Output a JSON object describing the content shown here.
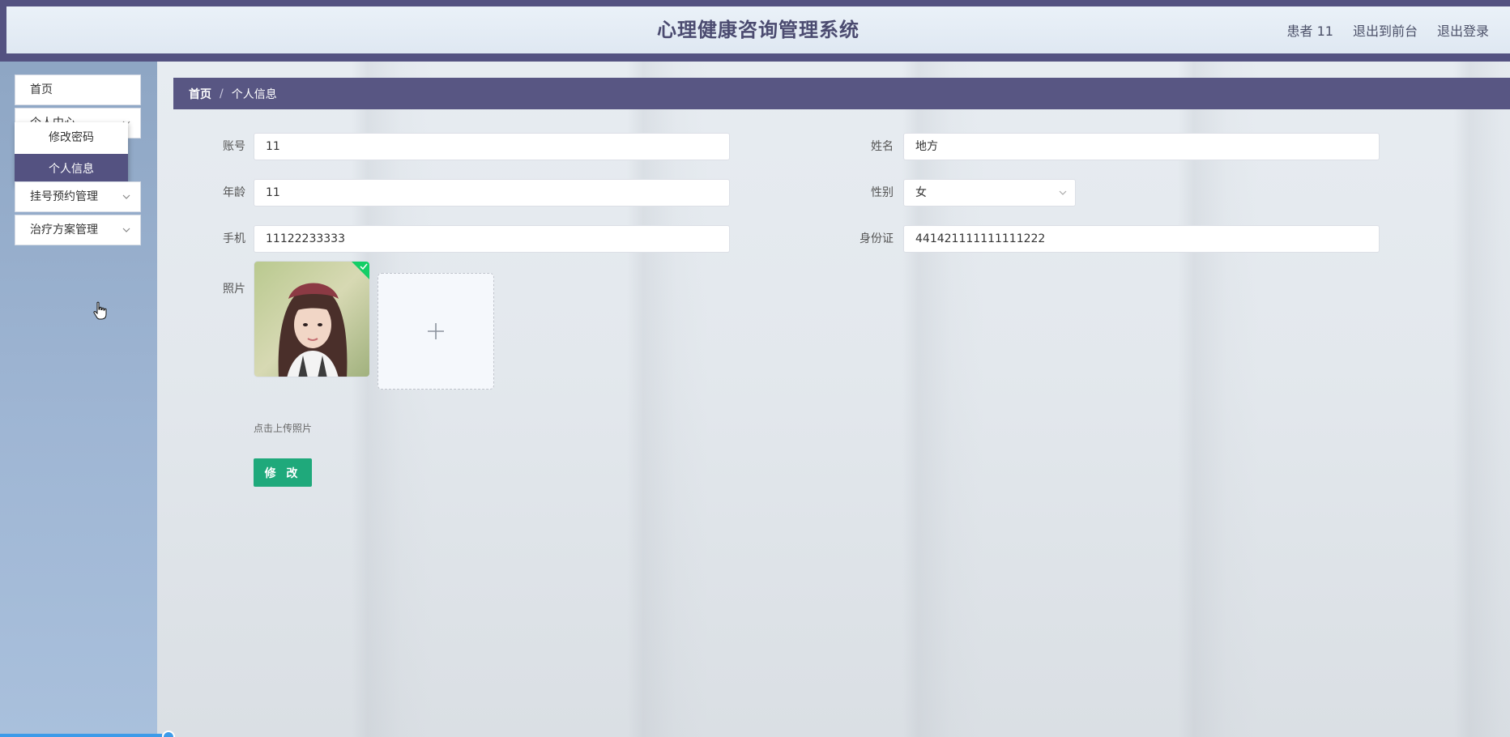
{
  "header": {
    "title": "心理健康咨询管理系统",
    "user_label": "患者 11",
    "back_to_front": "退出到前台",
    "logout": "退出登录"
  },
  "sidebar": {
    "items": [
      {
        "label": "首页"
      },
      {
        "label": "个人中心",
        "expanded": true,
        "children": [
          {
            "label": "修改密码",
            "active": false
          },
          {
            "label": "个人信息",
            "active": true
          }
        ]
      },
      {
        "label": "挂号预约管理"
      },
      {
        "label": "治疗方案管理"
      }
    ]
  },
  "breadcrumb": {
    "home": "首页",
    "separator": "/",
    "current": "个人信息"
  },
  "form": {
    "account_label": "账号",
    "account_value": "11",
    "name_label": "姓名",
    "name_value": "地方",
    "age_label": "年龄",
    "age_value": "11",
    "gender_label": "性别",
    "gender_value": "女",
    "phone_label": "手机",
    "phone_value": "11122233333",
    "id_label": "身份证",
    "id_value": "441421111111111222",
    "photo_label": "照片",
    "upload_hint": "点击上传照片",
    "submit_label": "修 改"
  },
  "colors": {
    "primary": "#545281",
    "success": "#1fa97b",
    "sidebar_bg": "#9fb6d4"
  }
}
